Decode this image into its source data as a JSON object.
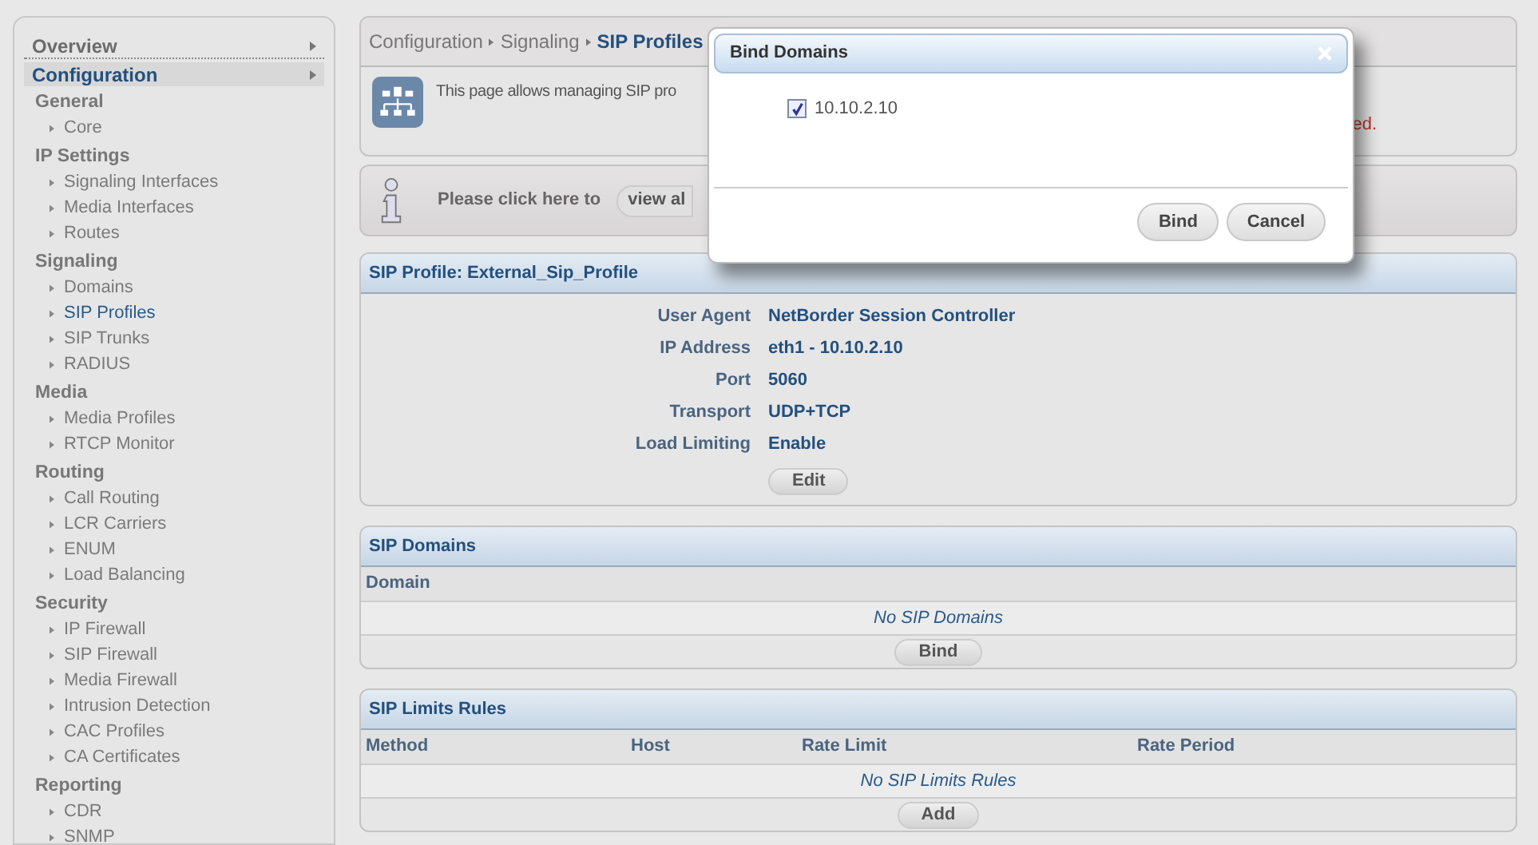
{
  "sidebar": {
    "menus": [
      {
        "label": "Overview",
        "selected": false
      },
      {
        "label": "Configuration",
        "selected": true
      }
    ],
    "sections": [
      {
        "title": "General",
        "items": [
          {
            "label": "Core",
            "selected": false
          }
        ]
      },
      {
        "title": "IP Settings",
        "items": [
          {
            "label": "Signaling Interfaces",
            "selected": false
          },
          {
            "label": "Media Interfaces",
            "selected": false
          },
          {
            "label": "Routes",
            "selected": false
          }
        ]
      },
      {
        "title": "Signaling",
        "items": [
          {
            "label": "Domains",
            "selected": false
          },
          {
            "label": "SIP Profiles",
            "selected": true
          },
          {
            "label": "SIP Trunks",
            "selected": false
          },
          {
            "label": "RADIUS",
            "selected": false
          }
        ]
      },
      {
        "title": "Media",
        "items": [
          {
            "label": "Media Profiles",
            "selected": false
          },
          {
            "label": "RTCP Monitor",
            "selected": false
          }
        ]
      },
      {
        "title": "Routing",
        "items": [
          {
            "label": "Call Routing",
            "selected": false
          },
          {
            "label": "LCR Carriers",
            "selected": false
          },
          {
            "label": "ENUM",
            "selected": false
          },
          {
            "label": "Load Balancing",
            "selected": false
          }
        ]
      },
      {
        "title": "Security",
        "items": [
          {
            "label": "IP Firewall",
            "selected": false
          },
          {
            "label": "SIP Firewall",
            "selected": false
          },
          {
            "label": "Media Firewall",
            "selected": false
          },
          {
            "label": "Intrusion Detection",
            "selected": false
          },
          {
            "label": "CAC Profiles",
            "selected": false
          },
          {
            "label": "CA Certificates",
            "selected": false
          }
        ]
      },
      {
        "title": "Reporting",
        "items": [
          {
            "label": "CDR",
            "selected": false
          },
          {
            "label": "SNMP",
            "selected": false
          }
        ]
      }
    ]
  },
  "breadcrumb": [
    "Configuration",
    "Signaling",
    "SIP Profiles"
  ],
  "intro": {
    "text": "This page allows managing SIP pro",
    "warning": "ed."
  },
  "info": {
    "text": "Please click here to",
    "button": "view al"
  },
  "profile": {
    "title": "SIP Profile: External_Sip_Profile",
    "fields": [
      {
        "label": "User Agent",
        "value": "NetBorder Session Controller"
      },
      {
        "label": "IP Address",
        "value": "eth1 - 10.10.2.10"
      },
      {
        "label": "Port",
        "value": "5060"
      },
      {
        "label": "Transport",
        "value": "UDP+TCP"
      },
      {
        "label": "Load Limiting",
        "value": "Enable"
      }
    ],
    "button": "Edit"
  },
  "domains": {
    "title": "SIP Domains",
    "columns": [
      "Domain"
    ],
    "empty": "No SIP Domains",
    "button": "Bind"
  },
  "limits": {
    "title": "SIP Limits Rules",
    "columns": [
      "Method",
      "Host",
      "Rate Limit",
      "Rate Period"
    ],
    "empty": "No SIP Limits Rules",
    "button": "Add"
  },
  "dialog": {
    "title": "Bind Domains",
    "options": [
      {
        "label": "10.10.2.10",
        "checked": true
      }
    ],
    "buttons": [
      "Bind",
      "Cancel"
    ]
  }
}
